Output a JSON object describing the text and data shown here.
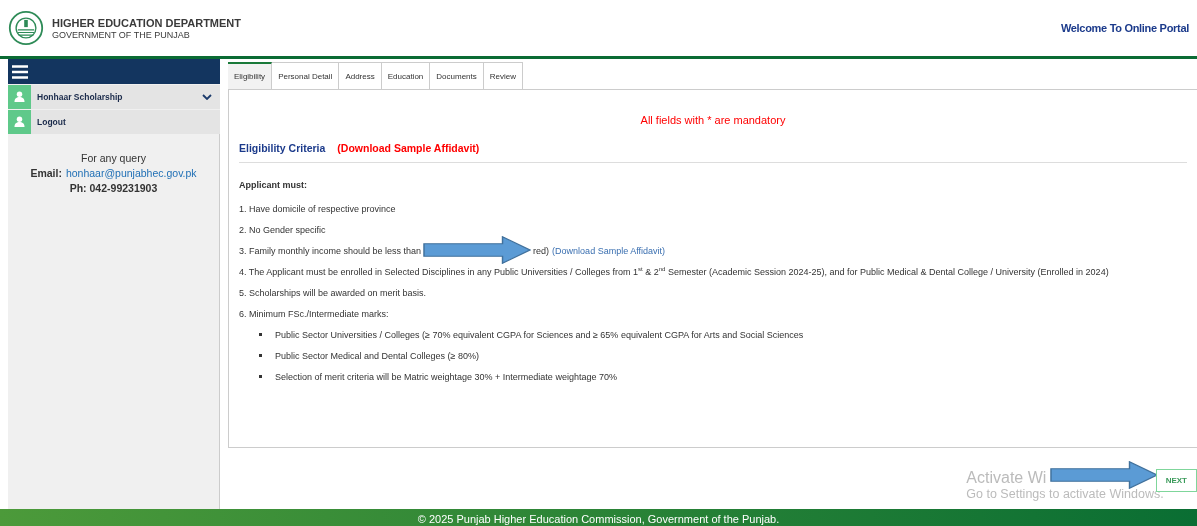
{
  "header": {
    "title": "HIGHER EDUCATION DEPARTMENT",
    "subtitle": "GOVERNMENT OF THE PUNJAB",
    "welcome": "Welcome To Online Portal"
  },
  "sidebar": {
    "items": [
      {
        "label": "Honhaar Scholarship",
        "kind": "dropdown"
      },
      {
        "label": "Logout",
        "kind": "link"
      }
    ],
    "contact": {
      "query": "For any query",
      "email_label": "Email:",
      "email": "honhaar@punjabhec.gov.pk",
      "phone": "Ph: 042-99231903"
    }
  },
  "tabs": [
    {
      "label": "Eligibility",
      "selected": true
    },
    {
      "label": "Personal Detail",
      "selected": false
    },
    {
      "label": "Address",
      "selected": false
    },
    {
      "label": "Education",
      "selected": false
    },
    {
      "label": "Documents",
      "selected": false
    },
    {
      "label": "Review",
      "selected": false
    }
  ],
  "notice": "All fields with * are mandatory",
  "section": {
    "title": "Eligibility Criteria",
    "link": "(Download Sample Affidavit)"
  },
  "criteria": {
    "intro": "Applicant must:",
    "items": [
      {
        "text": "1. Have domicile of respective province"
      },
      {
        "text": "2. No Gender specific"
      },
      {
        "text": "3. Family monthly income should be less than",
        "covered": true,
        "tail": "red)",
        "link": "(Download Sample Affidavit)"
      },
      {
        "text": "4. The Applicant must be enrolled in Selected Disciplines in any Public Universities / Colleges from 1$^{st}$ & 2$^{nd}$ Semester (Academic Session 2024-25), and for Public Medical & Dental College / University (Enrolled in 2024)"
      },
      {
        "text": "5. Scholarships will be awarded on merit basis."
      },
      {
        "text": "6. Minimum FSc./Intermediate marks:",
        "bullets": [
          "Public Sector Universities / Colleges (≥ 70% equivalent CGPA for Sciences and ≥ 65% equivalent CGPA for Arts and Social Sciences",
          "Public Sector Medical and Dental Colleges (≥ 80%)",
          "Selection of merit criteria will be Matric weightage 30% + Intermediate weightage 70%"
        ]
      }
    ]
  },
  "next_button": "NEXT",
  "activation": {
    "title": "Activate Wi",
    "hint": "Go to Settings to activate Windows."
  },
  "footer": "© 2025 Punjab Higher Education Commission, Government of the Punjab."
}
